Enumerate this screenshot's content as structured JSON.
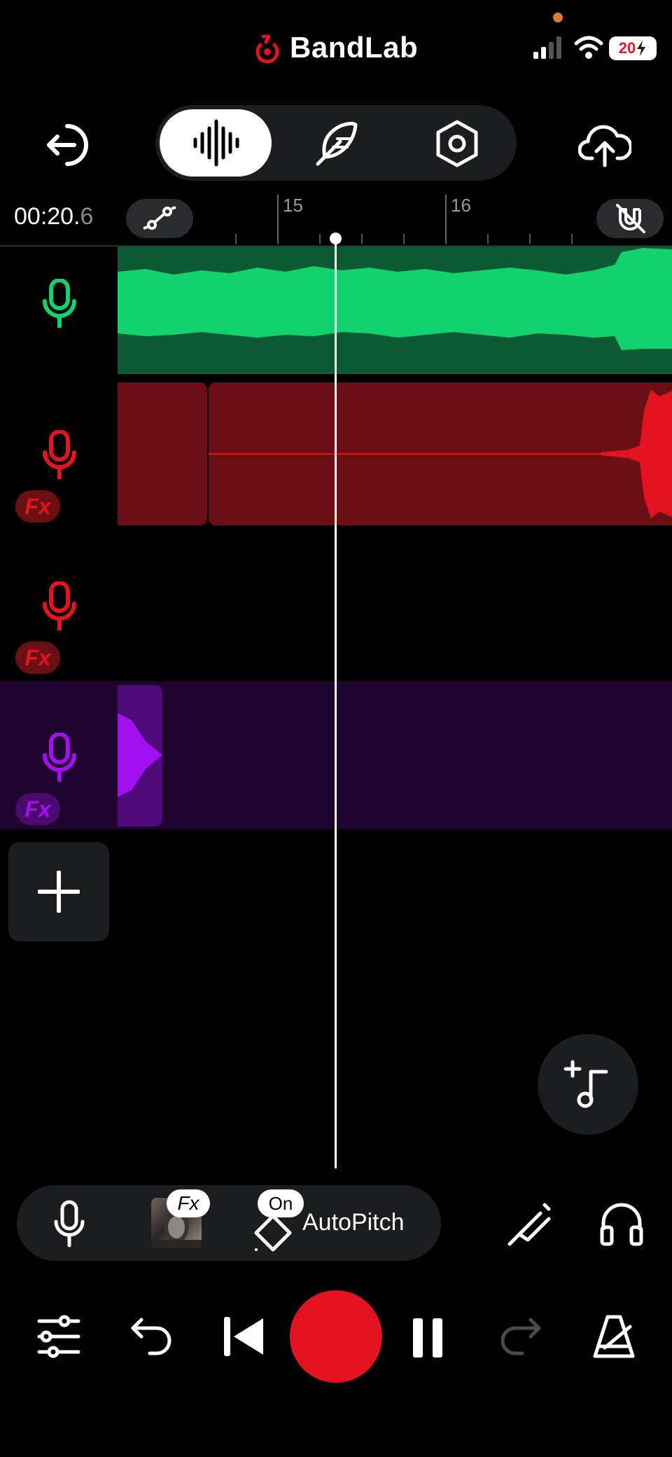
{
  "app": {
    "brand": "BandLab"
  },
  "status_bar": {
    "battery": "20"
  },
  "header": {
    "modes": [
      "waveform-mode",
      "effects-mode",
      "settings-mode"
    ],
    "active_mode": "waveform-mode"
  },
  "timeline": {
    "time_main": "00:20.",
    "time_frac": "6",
    "ruler_labels": [
      "15",
      "16"
    ]
  },
  "tracks": [
    {
      "name": "track-1",
      "color": "#12d26e",
      "fx": false
    },
    {
      "name": "track-2",
      "color": "#e3141f",
      "fx": true,
      "fx_label": "Fx"
    },
    {
      "name": "track-3",
      "color": "#e3141f",
      "fx": true,
      "fx_label": "Fx"
    },
    {
      "name": "track-4",
      "color": "#a10eef",
      "fx": true,
      "fx_label": "Fx"
    }
  ],
  "toolbar": {
    "fx_label": "Fx",
    "on_label": "On",
    "autopitch_label": "AutoPitch"
  },
  "colors": {
    "accent_red": "#e3141f",
    "green": "#12d26e",
    "purple": "#a10eef",
    "panel": "#1c1d20"
  }
}
